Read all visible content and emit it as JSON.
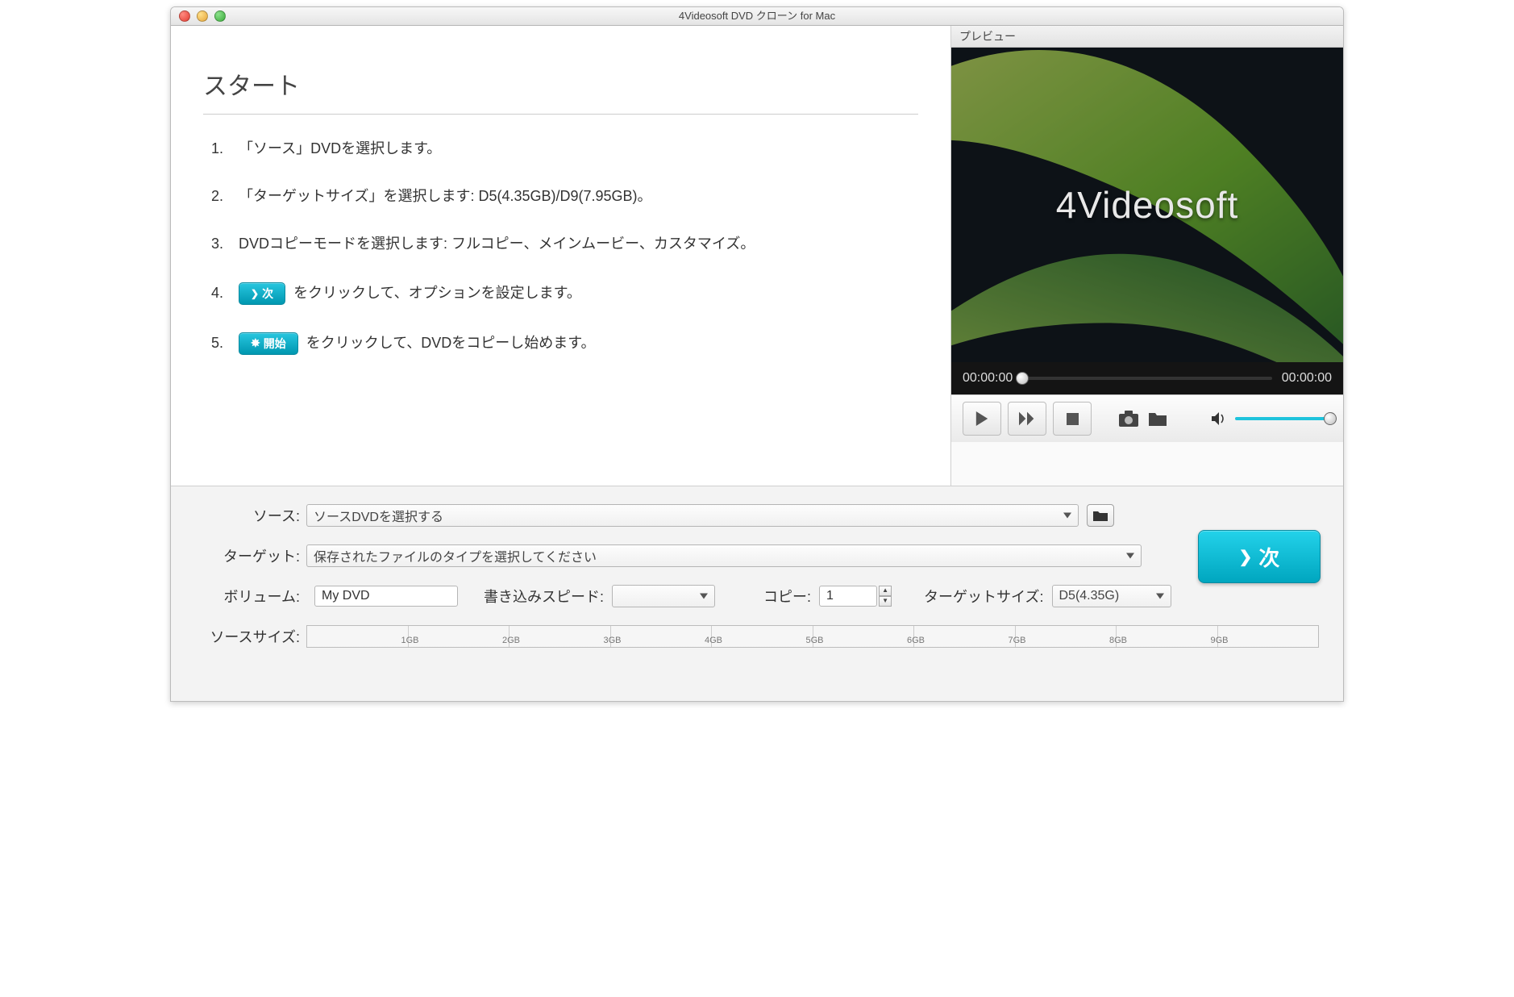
{
  "window": {
    "title": "4Videosoft DVD クローン for Mac"
  },
  "start": {
    "heading": "スタート",
    "steps": [
      {
        "n": "1.",
        "text": "「ソース」DVDを選択します。"
      },
      {
        "n": "2.",
        "text": "「ターゲットサイズ」を選択します: D5(4.35GB)/D9(7.95GB)。"
      },
      {
        "n": "3.",
        "text": "DVDコピーモードを選択します: フルコピー、メインムービー、カスタマイズ。"
      },
      {
        "n": "4.",
        "btn": "次",
        "text_after": "をクリックして、オプションを設定します。"
      },
      {
        "n": "5.",
        "btn": "開始",
        "text_after": "をクリックして、DVDをコピーし始めます。"
      }
    ]
  },
  "preview": {
    "header": "プレビュー",
    "brand": "4Videosoft",
    "time_current": "00:00:00",
    "time_total": "00:00:00",
    "icons": {
      "play": "play-icon",
      "fast_forward": "fast-forward-icon",
      "stop": "stop-icon",
      "snapshot": "camera-icon",
      "open_folder": "folder-icon",
      "volume": "volume-icon"
    }
  },
  "form": {
    "source_label": "ソース:",
    "source_value": "ソースDVDを選択する",
    "target_label": "ターゲット:",
    "target_value": "保存されたファイルのタイプを選択してください",
    "volume_label": "ボリューム:",
    "volume_value": "My DVD",
    "speed_label": "書き込みスピード:",
    "speed_value": "",
    "copies_label": "コピー:",
    "copies_value": "1",
    "targetsize_label": "ターゲットサイズ:",
    "targetsize_value": "D5(4.35G)",
    "sourcesize_label": "ソースサイズ:",
    "size_ticks": [
      "1GB",
      "2GB",
      "3GB",
      "4GB",
      "5GB",
      "6GB",
      "7GB",
      "8GB",
      "9GB"
    ],
    "next_button": "次"
  }
}
